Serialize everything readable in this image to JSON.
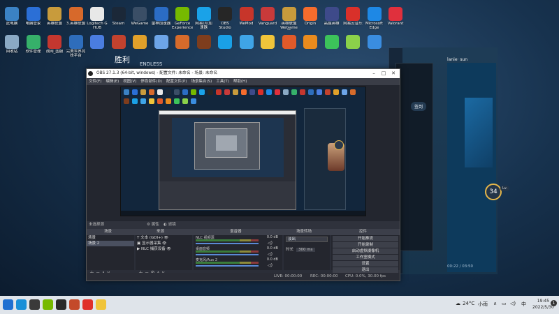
{
  "desktop": {
    "icons_row1": [
      {
        "label": "此电脑",
        "color": "#3b82c4"
      },
      {
        "label": "电脑管家",
        "color": "#2b6fd6"
      },
      {
        "label": "英雄联盟",
        "color": "#c89b3c"
      },
      {
        "label": "3.英雄联盟",
        "color": "#d7692b"
      },
      {
        "label": "Logitech G HUB",
        "color": "#e8e8e8"
      },
      {
        "label": "Steam",
        "color": "#1b2838"
      },
      {
        "label": "WeGame",
        "color": "#3a4e66"
      },
      {
        "label": "雷神加速器",
        "color": "#2b6cc4"
      },
      {
        "label": "GeForce Experience",
        "color": "#76b900"
      },
      {
        "label": "网易UU加速器",
        "color": "#1aa2e8"
      },
      {
        "label": "OBS Studio",
        "color": "#262626"
      },
      {
        "label": "WeMod",
        "color": "#c7352a"
      },
      {
        "label": "Vanguard",
        "color": "#c83a3a"
      },
      {
        "label": "英雄联盟WeGame版",
        "color": "#c89b3c"
      },
      {
        "label": "Origin",
        "color": "#f56c2d"
      },
      {
        "label": "高能英雄",
        "color": "#3e4a8a"
      },
      {
        "label": "网易云音乐",
        "color": "#d9302a"
      },
      {
        "label": "Microsoft Edge",
        "color": "#1e88e5"
      },
      {
        "label": "Valorant",
        "color": "#e0303d"
      }
    ],
    "icons_row2": [
      {
        "label": "回收站",
        "color": "#8aa9c4"
      },
      {
        "label": "软件管理",
        "color": "#36b06a"
      },
      {
        "label": "战网_国服",
        "color": "#c4372f"
      },
      {
        "label": "完美世界竞技平台",
        "color": "#2e6dbb"
      },
      {
        "label": "",
        "color": "#4a7de0"
      },
      {
        "label": "",
        "color": "#c2422e"
      },
      {
        "label": "",
        "color": "#e0a02a"
      },
      {
        "label": "",
        "color": "#6da5e8"
      },
      {
        "label": "",
        "color": "#d66b2b"
      },
      {
        "label": "",
        "color": "#7e3d1d"
      },
      {
        "label": "",
        "color": "#1aa0e6"
      },
      {
        "label": "",
        "color": "#3fa4e6"
      },
      {
        "label": "",
        "color": "#f0c43a"
      },
      {
        "label": "",
        "color": "#e05a2a"
      },
      {
        "label": "",
        "color": "#e98b1e"
      },
      {
        "label": "",
        "color": "#3cc35a"
      },
      {
        "label": "",
        "color": "#8bd14a"
      },
      {
        "label": "",
        "color": "#3a8de0"
      }
    ]
  },
  "background": {
    "victory_text": "胜利",
    "victory_sub": "ENDLESS",
    "music_user": "lanie· sun",
    "music_time": "00:22 / 03:50",
    "level_badge": "34",
    "level_small": "Lv.",
    "signin_label": "签到"
  },
  "obs": {
    "title": "OBS 27.1.3 (64-bit, windows) - 配置文件: 未命名 - 场景: 未命名",
    "menu": [
      "文件(F)",
      "编辑(E)",
      "视图(V)",
      "停靠部件(D)",
      "配置文件(P)",
      "场景集合(S)",
      "工具(T)",
      "帮助(H)"
    ],
    "no_source": "未选择源",
    "properties_btn": "属性",
    "filters_btn": "滤镜",
    "docks": {
      "scenes": "场景",
      "sources": "来源",
      "mixer": "混音器",
      "transitions": "场景转场",
      "controls": "控件"
    },
    "scenes": [
      "场景",
      "场景 2"
    ],
    "sources": [
      "文本 (GDI+)",
      "显示器采集",
      "NLC 捕获设备"
    ],
    "mixer": [
      {
        "name": "NLC 视频源",
        "db": "0.0 dB"
      },
      {
        "name": "桌面音频",
        "db": "0.0 dB"
      },
      {
        "name": "麦克风/Aux 2",
        "db": "0.0 dB"
      }
    ],
    "transition_type": "淡出",
    "duration_label": "时长",
    "duration_value": "300 ms",
    "controls": [
      "开始推流",
      "开始录制",
      "启动虚拟摄像机",
      "工作室模式",
      "设置",
      "退出"
    ],
    "status": {
      "live": "LIVE: 00:00:00",
      "rec": "REC: 00:00:00",
      "cpu": "CPU: 0.0%, 30.00 fps"
    }
  },
  "taskbar": {
    "icons": [
      {
        "name": "start",
        "color": "#1f6fd1"
      },
      {
        "name": "search",
        "color": "#1a8fd8"
      },
      {
        "name": "taskview",
        "color": "#3a3a3a"
      },
      {
        "name": "nvidia",
        "color": "#76b900"
      },
      {
        "name": "obs",
        "color": "#2a2a2a"
      },
      {
        "name": "game",
        "color": "#c44a2a"
      },
      {
        "name": "music",
        "color": "#e0302a"
      },
      {
        "name": "app",
        "color": "#f0c43a"
      }
    ],
    "weather": "24°C",
    "wind": "小雨",
    "ime": "中",
    "time": "19:45",
    "date": "2022/5/30",
    "notif_count": "1"
  }
}
